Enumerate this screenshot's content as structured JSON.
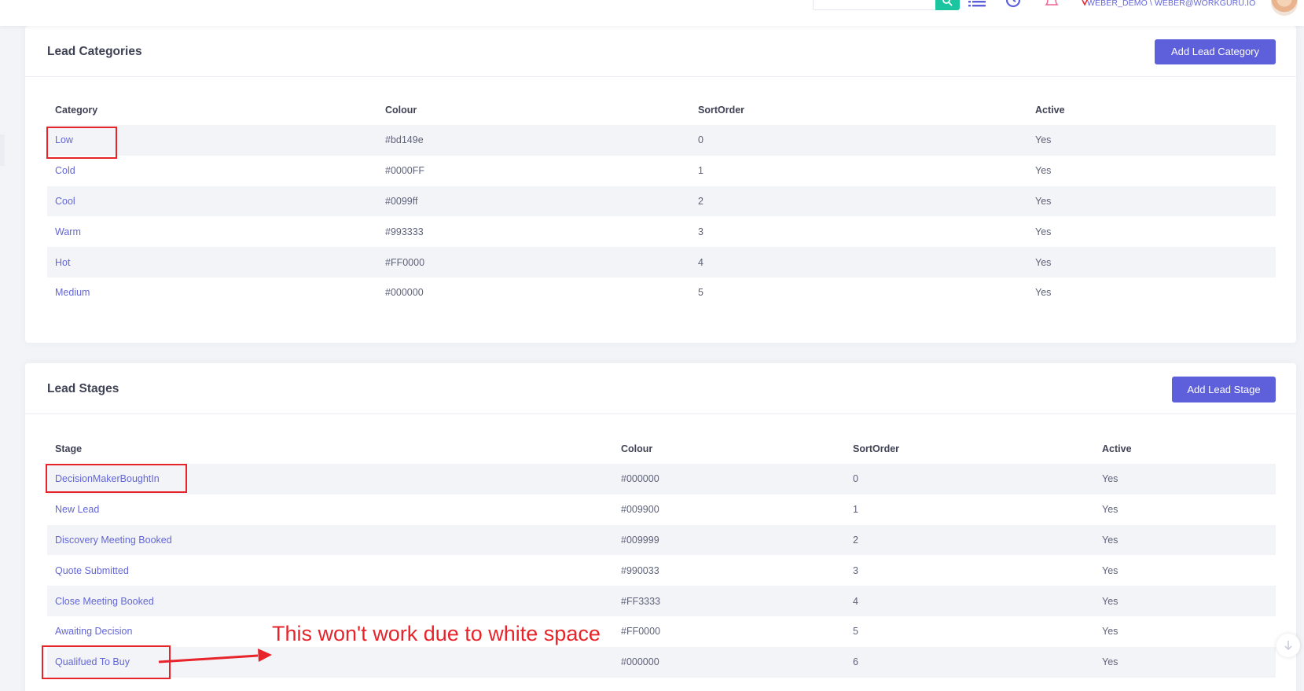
{
  "header": {
    "search_placeholder": "",
    "user_label": "WEBER_DEMO \\ WEBER@WORKGURU.IO",
    "icons": [
      "search-icon",
      "list-icon",
      "clock-icon",
      "bell-icon",
      "avatar"
    ],
    "accent_color": "#1bc5a0"
  },
  "lead_categories": {
    "title": "Lead Categories",
    "add_button": "Add Lead Category",
    "columns": [
      "Category",
      "Colour",
      "SortOrder",
      "Active"
    ],
    "rows": [
      {
        "category": "Low",
        "colour": "#bd149e",
        "sort_order": "0",
        "active": "Yes"
      },
      {
        "category": "Cold",
        "colour": "#0000FF",
        "sort_order": "1",
        "active": "Yes"
      },
      {
        "category": "Cool",
        "colour": "#0099ff",
        "sort_order": "2",
        "active": "Yes"
      },
      {
        "category": "Warm",
        "colour": "#993333",
        "sort_order": "3",
        "active": "Yes"
      },
      {
        "category": "Hot",
        "colour": "#FF0000",
        "sort_order": "4",
        "active": "Yes"
      },
      {
        "category": "Medium",
        "colour": "#000000",
        "sort_order": "5",
        "active": "Yes"
      }
    ]
  },
  "lead_stages": {
    "title": "Lead Stages",
    "add_button": "Add Lead Stage",
    "columns": [
      "Stage",
      "Colour",
      "SortOrder",
      "Active"
    ],
    "rows": [
      {
        "stage": "DecisionMakerBoughtIn",
        "colour": "#000000",
        "sort_order": "0",
        "active": "Yes"
      },
      {
        "stage": "New Lead",
        "colour": "#009900",
        "sort_order": "1",
        "active": "Yes"
      },
      {
        "stage": "Discovery Meeting Booked",
        "colour": "#009999",
        "sort_order": "2",
        "active": "Yes"
      },
      {
        "stage": "Quote Submitted",
        "colour": "#990033",
        "sort_order": "3",
        "active": "Yes"
      },
      {
        "stage": "Close Meeting Booked",
        "colour": "#FF3333",
        "sort_order": "4",
        "active": "Yes"
      },
      {
        "stage": "Awaiting Decision",
        "colour": "#FF0000",
        "sort_order": "5",
        "active": "Yes"
      },
      {
        "stage": "Qualifued To Buy",
        "colour": "#000000",
        "sort_order": "6",
        "active": "Yes"
      }
    ]
  },
  "annotation": {
    "text": "This won't work due to white space",
    "color": "#e8242b"
  },
  "colors": {
    "primary_button": "#5d5fdb",
    "link": "#6366d6",
    "row_stripe": "#f3f4f8"
  }
}
